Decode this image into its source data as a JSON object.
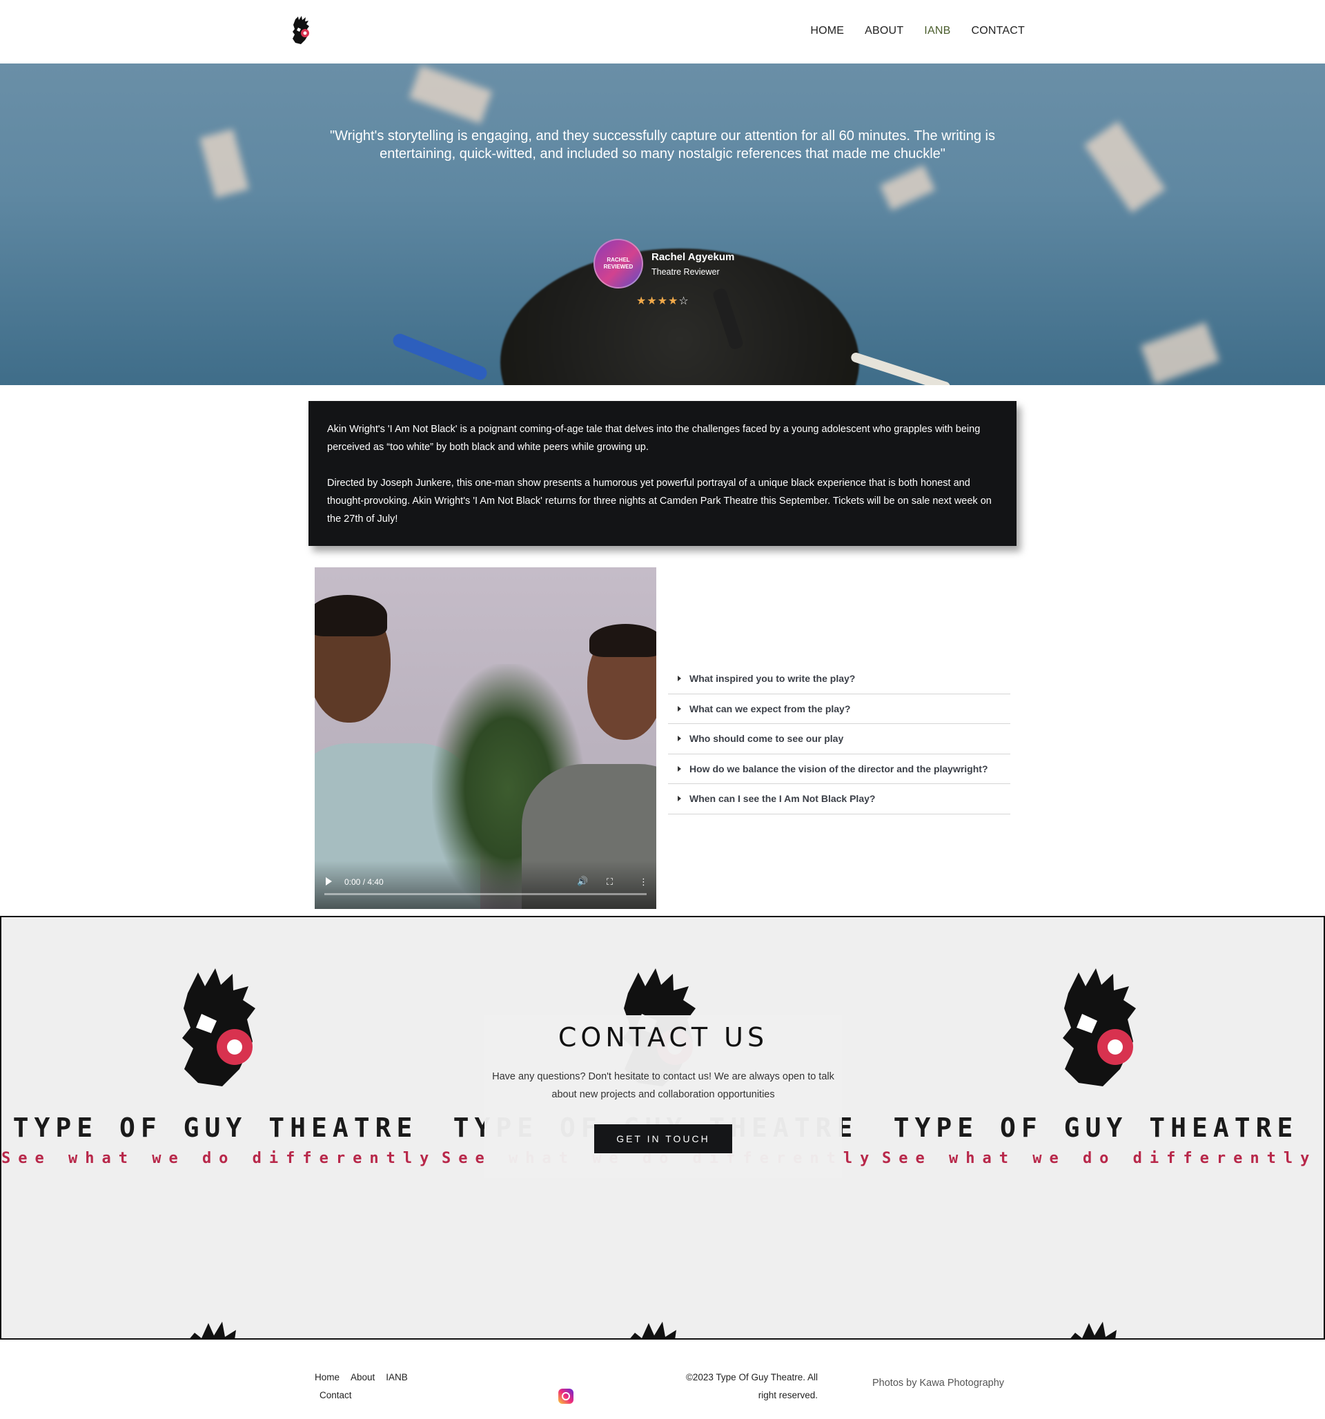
{
  "header": {
    "logo_icon": "bearded-man-headphones-logo",
    "nav": [
      {
        "label": "HOME",
        "active": false
      },
      {
        "label": "ABOUT",
        "active": false
      },
      {
        "label": "IANB",
        "active": true
      },
      {
        "label": "CONTACT",
        "active": false
      }
    ]
  },
  "hero": {
    "quote": "\"Wright's storytelling is engaging, and they successfully capture our attention for all 60 minutes. The writing is entertaining, quick-witted, and included so many nostalgic references that made me chuckle\"",
    "reviewer": {
      "badge_line1": "RACHEL",
      "badge_line2": "REVIEWED",
      "name": "Rachel Agyekum",
      "role": "Theatre Reviewer"
    },
    "rating": 4,
    "rating_max": 5,
    "star_color": "#f0a94a"
  },
  "description": {
    "paragraph1": "Akin Wright's 'I Am Not Black' is a poignant coming-of-age tale that delves into the challenges faced by a young adolescent who grapples with being perceived as “too white” by both black and white peers while growing up.",
    "paragraph2": "Directed by Joseph Junkere, this one-man show presents a humorous yet powerful portrayal of a unique black experience that is both honest and thought-provoking. Akin Wright's 'I Am Not Black' returns for three nights at Camden Park Theatre this September. Tickets will be on sale next week on the 27th of July!"
  },
  "video": {
    "time": "0:00 / 4:40",
    "progress": 0
  },
  "faq": [
    "What inspired you to write the play?",
    "What can we expect from the play?",
    "Who should come to see our play",
    "How do we balance the vision of the director and the playwright?",
    "When can I see the I Am Not Black Play?"
  ],
  "contact": {
    "brand_name": "TYPE OF GUY THEATRE",
    "brand_tagline": "See what we do differently",
    "title": "CONTACT US",
    "text": "Have any questions? Don't hesitate to contact us! We are always open to talk about new projects and collaboration opportunities",
    "button": "GET IN TOUCH",
    "accent": "#b8284a"
  },
  "footer": {
    "links": [
      "Home",
      "About",
      "IANB",
      "Contact"
    ],
    "social_icon": "instagram-icon",
    "copyright": "©2023 Type Of Guy Theatre. All right reserved.",
    "credits": "Photos by Kawa Photography"
  }
}
